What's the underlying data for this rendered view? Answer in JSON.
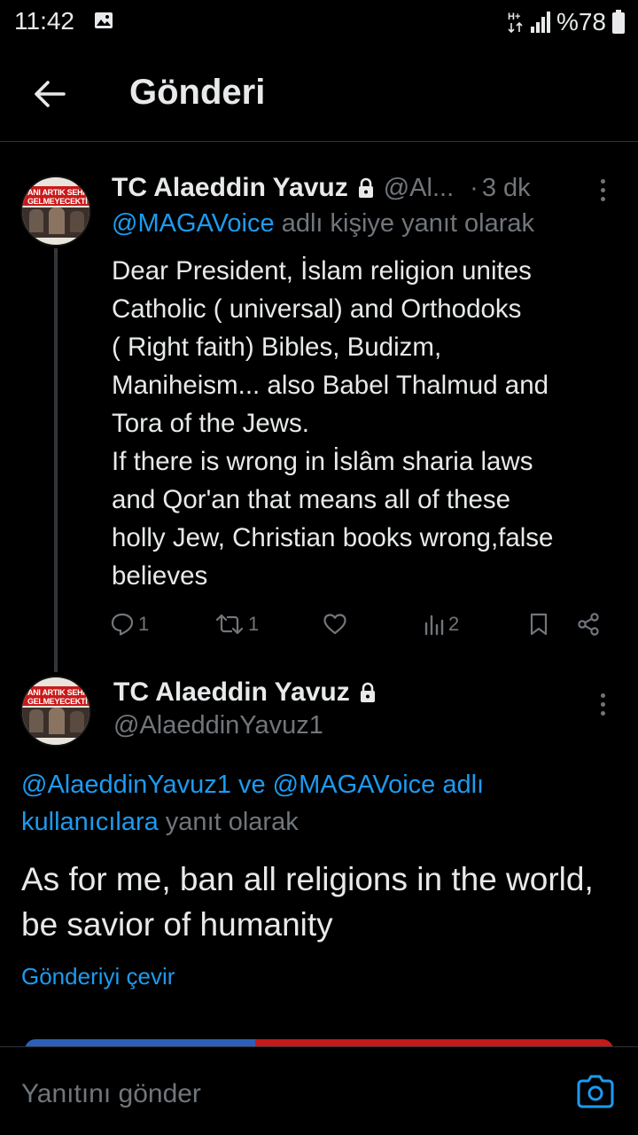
{
  "statusbar": {
    "time": "11:42",
    "network": "H+",
    "battery": "%78"
  },
  "header": {
    "title": "Gönderi"
  },
  "tweet1": {
    "name": "TC Alaeddin Yavuz",
    "handle": "@Al...",
    "separator": "·",
    "time": "3 dk",
    "reply_mention": "@MAGAVoice",
    "reply_suffix": " adlı kişiye yanıt olarak",
    "body": "Dear President, İslam religion unites\nCatholic ( universal) and Orthodoks\n( Right faith) Bibles, Budizm,\nManiheism... also Babel Thalmud and\nTora of the Jews.\nIf there is wrong in İslâm sharia laws\nand Qor'an that means all of these\nholly Jew, Christian books wrong,false\nbelieves",
    "replies": "1",
    "reposts": "1",
    "views": "2"
  },
  "tweet2": {
    "name": "TC Alaeddin Yavuz",
    "handle": "@AlaeddinYavuz1",
    "reply_mention1": "@AlaeddinYavuz1",
    "reply_conj": " ve ",
    "reply_mention2": "@MAGAVoice adlı kullanıcılara",
    "reply_suffix": " yanıt olarak",
    "body": "As for me, ban all religions in the world, be savior of humanity",
    "translate": "Gönderiyi çevir"
  },
  "avatar": {
    "text": "ANI ARTIK SEHİ GELMEYECEKTİ"
  },
  "reply_bar": {
    "placeholder": "Yanıtını gönder"
  },
  "colors": {
    "background": "#000000",
    "text": "#e7e9ea",
    "secondary": "#71767b",
    "accent": "#1d9bf0",
    "divider": "#2f3336"
  }
}
